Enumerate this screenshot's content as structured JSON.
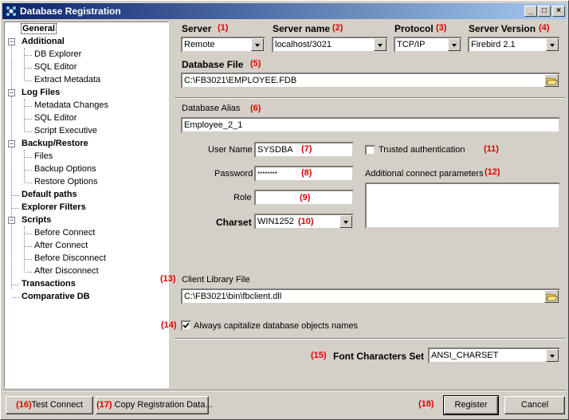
{
  "window": {
    "title": "Database Registration"
  },
  "titlebar_buttons": {
    "minimize": "_",
    "maximize": "□",
    "close": "×"
  },
  "tree": {
    "items": [
      {
        "label": "General",
        "bold": true,
        "level": 0
      },
      {
        "label": "Additional",
        "bold": true,
        "level": 0
      },
      {
        "label": "DB Explorer",
        "bold": false,
        "level": 1
      },
      {
        "label": "SQL Editor",
        "bold": false,
        "level": 1
      },
      {
        "label": "Extract Metadata",
        "bold": false,
        "level": 1
      },
      {
        "label": "Log Files",
        "bold": true,
        "level": 0
      },
      {
        "label": "Metadata Changes",
        "bold": false,
        "level": 1
      },
      {
        "label": "SQL Editor",
        "bold": false,
        "level": 1
      },
      {
        "label": "Script Executive",
        "bold": false,
        "level": 1
      },
      {
        "label": "Backup/Restore",
        "bold": true,
        "level": 0
      },
      {
        "label": "Files",
        "bold": false,
        "level": 1
      },
      {
        "label": "Backup Options",
        "bold": false,
        "level": 1
      },
      {
        "label": "Restore Options",
        "bold": false,
        "level": 1
      },
      {
        "label": "Default paths",
        "bold": true,
        "level": 0
      },
      {
        "label": "Explorer Filters",
        "bold": true,
        "level": 0
      },
      {
        "label": "Scripts",
        "bold": true,
        "level": 0
      },
      {
        "label": "Before Connect",
        "bold": false,
        "level": 1
      },
      {
        "label": "After Connect",
        "bold": false,
        "level": 1
      },
      {
        "label": "Before Disconnect",
        "bold": false,
        "level": 1
      },
      {
        "label": "After Disconnect",
        "bold": false,
        "level": 1
      },
      {
        "label": "Transactions",
        "bold": true,
        "level": 0
      },
      {
        "label": "Comparative DB",
        "bold": true,
        "level": 0
      }
    ]
  },
  "server": {
    "label": "Server",
    "num": "(1)",
    "value": "Remote"
  },
  "server_name": {
    "label": "Server name",
    "num": "(2)",
    "value": "localhost/3021"
  },
  "protocol": {
    "label": "Protocol",
    "num": "(3)",
    "value": "TCP/IP"
  },
  "server_version": {
    "label": "Server Version",
    "num": "(4)",
    "value": "Firebird 2.1"
  },
  "database_file": {
    "label": "Database File",
    "num": "(5)",
    "value": "C:\\FB3021\\EMPLOYEE.FDB"
  },
  "database_alias": {
    "label": "Database Alias",
    "num": "(6)",
    "value": "Employee_2_1"
  },
  "user_name": {
    "label": "User Name",
    "num": "(7)",
    "value": "SYSDBA"
  },
  "password": {
    "label": "Password",
    "num": "(8)",
    "value": "********"
  },
  "role": {
    "label": "Role",
    "num": "(9)",
    "value": ""
  },
  "charset": {
    "label": "Charset",
    "num": "(10)",
    "value": "WIN1252"
  },
  "trusted_auth": {
    "label": "Trusted authentication",
    "num": "(11)",
    "checked": false
  },
  "additional_params": {
    "label": "Additional connect parameters",
    "num": "(12)",
    "value": ""
  },
  "client_library": {
    "label": "Client Library File",
    "num": "(13)",
    "value": "C:\\FB3021\\bin\\fbclient.dll"
  },
  "capitalize": {
    "label": "Always capitalize database objects names",
    "num": "(14)",
    "checked": true
  },
  "font_charset": {
    "label": "Font Characters Set",
    "num": "(15)",
    "value": "ANSI_CHARSET"
  },
  "buttons": {
    "test_connect_num": "(16)",
    "test_connect": "Test Connect",
    "copy_num": "(17)",
    "copy": "Copy Registration Data...",
    "register_num": "(18)",
    "register": "Register",
    "cancel": "Cancel"
  },
  "colors": {
    "accent_red": "#e00000",
    "title_start": "#0a246a",
    "title_end": "#a6caf0"
  }
}
